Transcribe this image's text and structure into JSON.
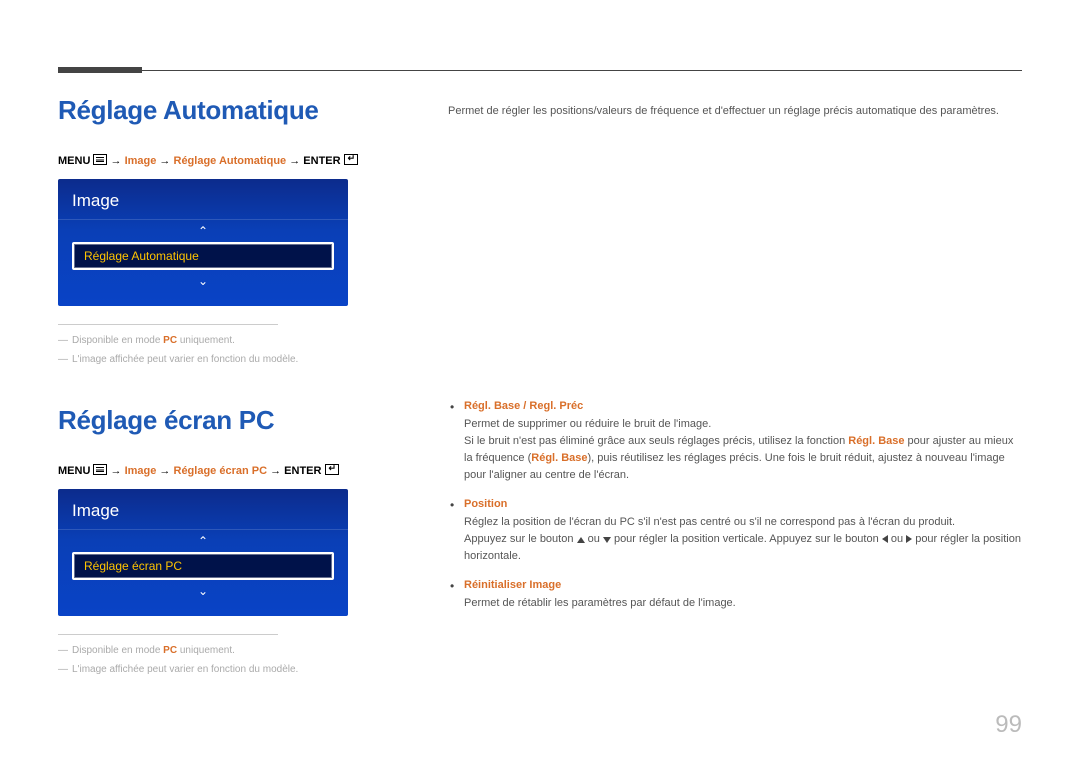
{
  "page": {
    "number": "99"
  },
  "section1": {
    "title": "Réglage Automatique",
    "nav": {
      "menu": "MENU",
      "path1": "Image",
      "path2": "Réglage Automatique",
      "enter": "ENTER"
    },
    "osd": {
      "title": "Image",
      "item": "Réglage Automatique"
    },
    "footnotes": {
      "a_pre": "Disponible en mode ",
      "a_pc": "PC",
      "a_post": " uniquement.",
      "b": "L'image affichée peut varier en fonction du modèle."
    },
    "right_desc": "Permet de régler les positions/valeurs de fréquence et d'effectuer un réglage précis automatique des paramètres."
  },
  "section2": {
    "title": "Réglage écran PC",
    "nav": {
      "menu": "MENU",
      "path1": "Image",
      "path2": "Réglage écran PC",
      "enter": "ENTER"
    },
    "osd": {
      "title": "Image",
      "item": "Réglage écran PC"
    },
    "footnotes": {
      "a_pre": "Disponible en mode ",
      "a_pc": "PC",
      "a_post": " uniquement.",
      "b": "L'image affichée peut varier en fonction du modèle."
    },
    "bullets": {
      "b1": {
        "title": "Régl. Base / Regl. Préc",
        "line1": "Permet de supprimer ou réduire le bruit de l'image.",
        "line2_pre": "Si le bruit n'est pas éliminé grâce aux seuls réglages précis, utilisez la fonction ",
        "line2_a1": "Régl. Base",
        "line2_mid": " pour ajuster au mieux la fréquence (",
        "line2_a2": "Régl. Base",
        "line2_post": "), puis réutilisez les réglages précis. Une fois le bruit réduit, ajustez à nouveau l'image pour l'aligner au centre de l'écran."
      },
      "b2": {
        "title": "Position",
        "line1": "Réglez la position de l'écran du PC s'il n'est pas centré ou s'il ne correspond pas à l'écran du produit.",
        "line2_pre": "Appuyez sur le bouton ",
        "line2_mid": " pour régler la position verticale. Appuyez sur le bouton ",
        "line2_post": " pour régler la position horizontale.",
        "ou": " ou "
      },
      "b3": {
        "title": "Réinitialiser Image",
        "line1": "Permet de rétablir les paramètres par défaut de l'image."
      }
    }
  }
}
